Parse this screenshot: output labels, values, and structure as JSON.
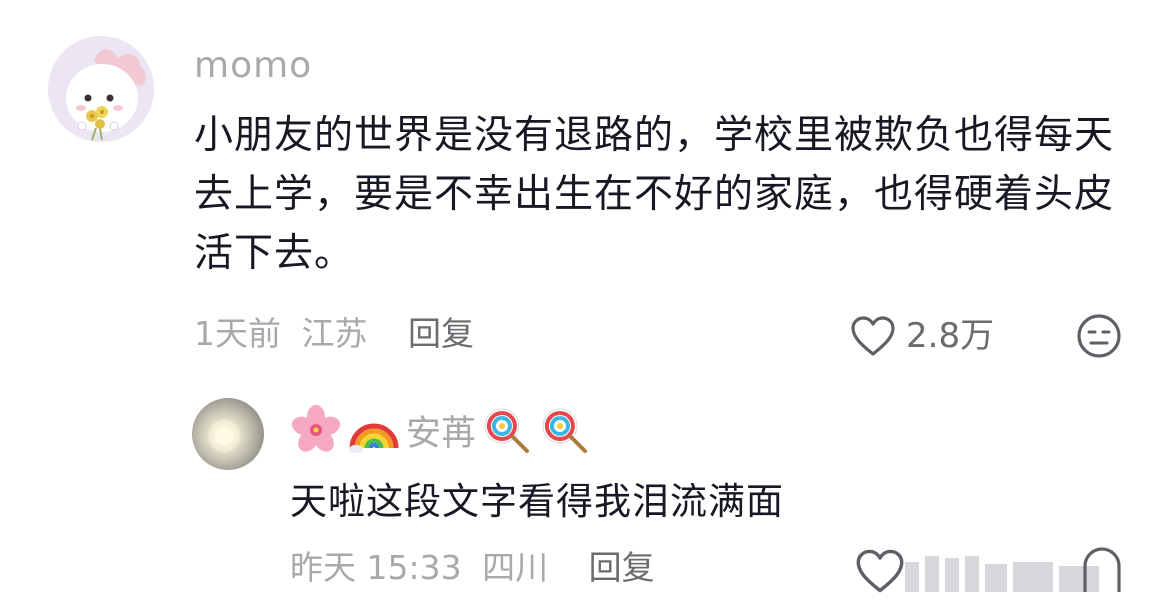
{
  "comment": {
    "username": "momo",
    "text": "小朋友的世界是没有退路的，学校里被欺负也得每天去上学，要是不幸出生在不好的家庭，也得硬着头皮活下去。",
    "time": "1天前",
    "location": "江苏",
    "reply_label": "回复",
    "like_count": "2.8万",
    "avatar_icon": "white-puppy-holding-flowers-avatar",
    "like_icon": "heart-outline-icon",
    "dislike_icon": "meh-face-icon"
  },
  "reply": {
    "username": "安苒",
    "username_emoji": [
      "cherry-blossom-emoji",
      "rainbow-emoji"
    ],
    "username_suffix_emoji": [
      "lollipop-emoji",
      "lollipop-emoji"
    ],
    "text": "天啦这段文字看得我泪流满面",
    "time": "昨天 15:33",
    "location": "四川",
    "reply_label": "回复",
    "avatar_icon": "sun-glow-avatar",
    "like_icon": "heart-outline-icon",
    "dislike_icon": "meh-face-icon"
  },
  "colors": {
    "text_primary": "#161823",
    "text_secondary": "#a9a9ad",
    "text_action": "#6b6b70",
    "icon_stroke": "#5f5f66"
  }
}
